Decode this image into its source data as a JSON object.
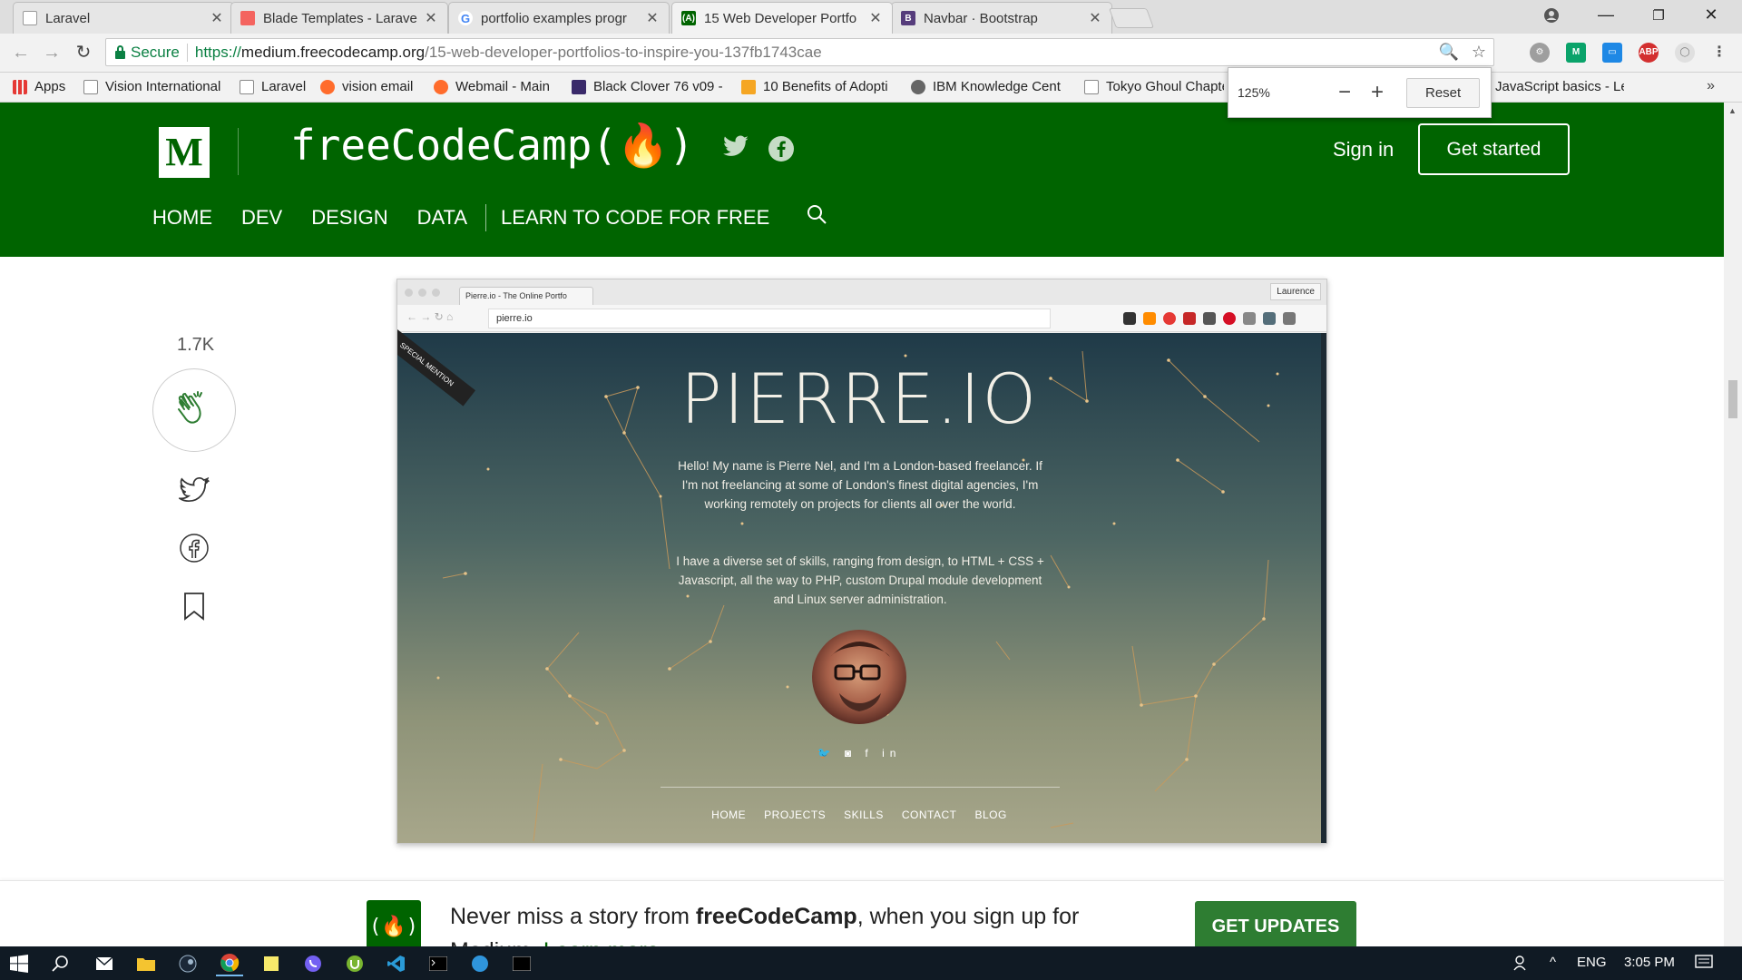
{
  "browser": {
    "tabs": [
      {
        "title": "Laravel",
        "favicon": "document-icon",
        "color": "#9e9e9e"
      },
      {
        "title": "Blade Templates - Larave",
        "favicon": "laravel-icon",
        "color": "#f4645f"
      },
      {
        "title": "portfolio examples progr",
        "favicon": "google-icon",
        "color": "#4285f4"
      },
      {
        "title": "15 Web Developer Portfo",
        "favicon": "freecodecamp-icon",
        "color": "#006400"
      },
      {
        "title": "Navbar · Bootstrap",
        "favicon": "bootstrap-icon",
        "color": "#563d7c"
      }
    ],
    "secure_label": "Secure",
    "url_scheme": "https://",
    "url_host": "medium.freecodecamp.org",
    "url_path": "/15-web-developer-portfolios-to-inspire-you-137fb1743cae",
    "bookmarks": [
      {
        "label": "Apps",
        "icon": "apps-grid-icon"
      },
      {
        "label": "Vision International",
        "icon": "document-icon"
      },
      {
        "label": "Laravel",
        "icon": "document-icon"
      },
      {
        "label": "vision email",
        "icon": "cpanel-icon"
      },
      {
        "label": "Webmail - Main",
        "icon": "cpanel-icon"
      },
      {
        "label": "Black Clover 76 v09 -",
        "icon": "manga-icon"
      },
      {
        "label": "10 Benefits of Adopti",
        "icon": "blog-icon"
      },
      {
        "label": "IBM Knowledge Cent",
        "icon": "ibm-icon"
      },
      {
        "label": "Tokyo Ghoul Chapte",
        "icon": "document-icon"
      },
      {
        "label": "JavaScript basics - Le",
        "icon": "document-icon"
      }
    ],
    "zoom": {
      "level": "125%",
      "minus": "−",
      "plus": "+",
      "reset": "Reset"
    }
  },
  "site": {
    "medium_logo": "M",
    "publication": "freeCodeCamp(🔥)",
    "sign_in": "Sign in",
    "get_started": "Get started",
    "nav": [
      "HOME",
      "DEV",
      "DESIGN",
      "DATA"
    ],
    "nav_extra": "LEARN TO CODE FOR FREE",
    "claps": "1.7K",
    "accent": "#006400"
  },
  "screenshot": {
    "tab_title": "Pierre.io - The Online Portfo",
    "user": "Laurence",
    "url": "pierre.io",
    "ribbon": "SPECIAL MENTION",
    "heading": "PIERRE.IO",
    "para1": "Hello! My name is Pierre Nel, and I'm a London-based freelancer. If I'm not freelancing at some of London's finest digital agencies, I'm working remotely on projects for clients all over the world.",
    "para2": "I have a diverse set of skills, ranging from design, to HTML + CSS + Javascript, all the way to PHP, custom Drupal module development and Linux server administration.",
    "social": "🐦 ◙ f in",
    "nav": [
      "HOME",
      "PROJECTS",
      "SKILLS",
      "CONTACT",
      "BLOG"
    ]
  },
  "banner": {
    "text_before": "Never miss a story from ",
    "text_bold": "freeCodeCamp",
    "text_after": ", when you sign up for Medium. ",
    "learn_more": "Learn more",
    "button": "GET UPDATES",
    "logo": "(🔥)"
  },
  "taskbar": {
    "language": "ENG",
    "time": "3:05 PM"
  }
}
